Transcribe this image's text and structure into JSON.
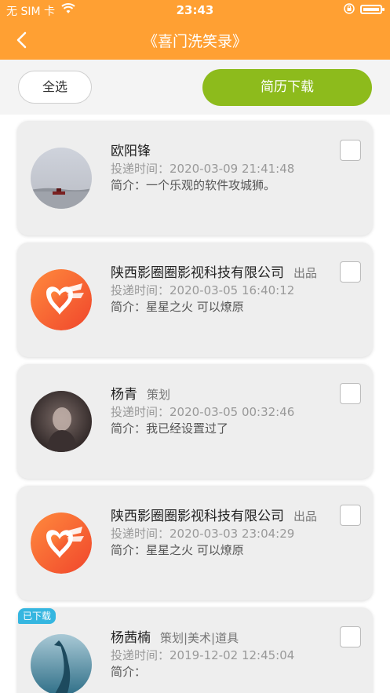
{
  "status_bar": {
    "carrier": "无 SIM 卡",
    "time": "23:43"
  },
  "navbar": {
    "title": "《喜门洗笑录》"
  },
  "toolbar": {
    "select_all": "全选",
    "download": "简历下载"
  },
  "items": [
    {
      "name": "欧阳锋",
      "role": "",
      "time": "投递时间：2020-03-09 21:41:48",
      "intro": "简介：一个乐观的软件攻城狮。",
      "avatar": "lake-photo",
      "badge": ""
    },
    {
      "name": "陕西影圈圈影视科技有限公司",
      "role": "出品",
      "time": "投递时间：2020-03-05 16:40:12",
      "intro": "简介：星星之火 可以燎原",
      "avatar": "company-logo",
      "badge": ""
    },
    {
      "name": "杨青",
      "role": "策划",
      "time": "投递时间：2020-03-05 00:32:46",
      "intro": "简介：我已经设置过了",
      "avatar": "portrait-photo",
      "badge": ""
    },
    {
      "name": "陕西影圈圈影视科技有限公司",
      "role": "出品",
      "time": "投递时间：2020-03-03 23:04:29",
      "intro": "简介：星星之火 可以燎原",
      "avatar": "company-logo",
      "badge": ""
    },
    {
      "name": "杨茜楠",
      "role": "策划|美术|道具",
      "time": "投递时间：2019-12-02 12:45:04",
      "intro": "简介：",
      "avatar": "whale-photo",
      "badge": "已下载"
    }
  ],
  "colors": {
    "header": "#ffa033",
    "download_button": "#8dbb1c",
    "badge": "#35b6e0"
  }
}
